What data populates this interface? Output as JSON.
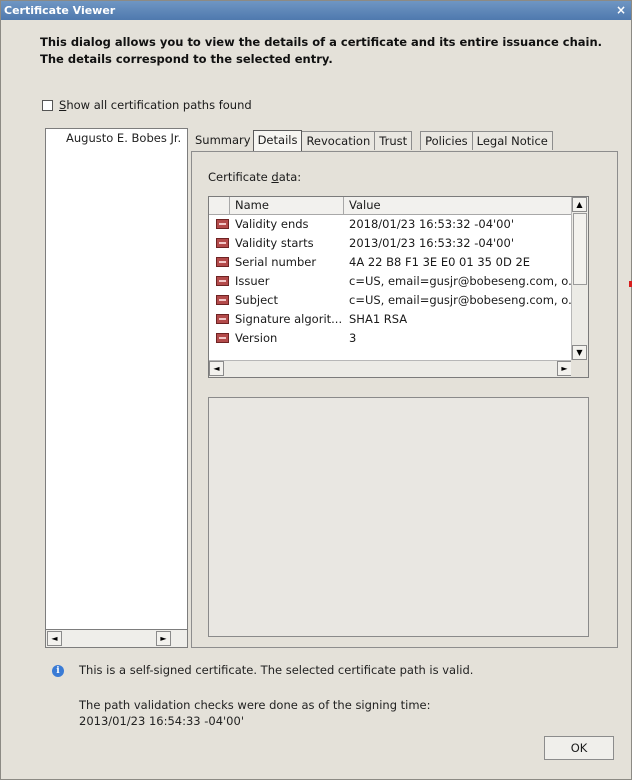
{
  "window": {
    "title": "Certificate Viewer",
    "close_glyph": "×"
  },
  "intro_text": "This dialog allows you to view the details of a certificate and its entire issuance chain. The details correspond to the selected entry.",
  "show_all": {
    "accel": "S",
    "label": "how all certification paths found",
    "checked": false
  },
  "tree": {
    "items": [
      "Augusto E. Bobes Jr."
    ],
    "scroll_left": "◄",
    "scroll_right": "►"
  },
  "tabs": [
    "Summary",
    "Details",
    "Revocation",
    "Trust",
    "Policies",
    "Legal Notice"
  ],
  "selected_tab": "Details",
  "certificate_data": {
    "label_pre": "Certificate ",
    "label_accel": "d",
    "label_post": "ata:",
    "columns": [
      "Name",
      "Value"
    ],
    "rows": [
      {
        "name": "Validity ends",
        "value": "2018/01/23 16:53:32 -04'00'"
      },
      {
        "name": "Validity starts",
        "value": "2013/01/23 16:53:32 -04'00'"
      },
      {
        "name": "Serial number",
        "value": "4A 22 B8 F1 3E E0 01 35 0D 2E"
      },
      {
        "name": "Issuer",
        "value": "c=US, email=gusjr@bobeseng.com, o..."
      },
      {
        "name": "Subject",
        "value": "c=US, email=gusjr@bobeseng.com, o..."
      },
      {
        "name": "Signature algorit...",
        "value": "SHA1 RSA"
      },
      {
        "name": "Version",
        "value": "3"
      }
    ],
    "scroll_up": "▲",
    "scroll_down": "▼",
    "scroll_left": "◄",
    "scroll_right": "►"
  },
  "status": {
    "info_glyph": "i",
    "message": "This is a self-signed certificate. The selected certificate path is valid.",
    "path_check_line1": "The path validation checks were done as of the signing time:",
    "path_check_line2": "2013/01/23 16:54:33 -04'00'"
  },
  "ok_label": "OK"
}
